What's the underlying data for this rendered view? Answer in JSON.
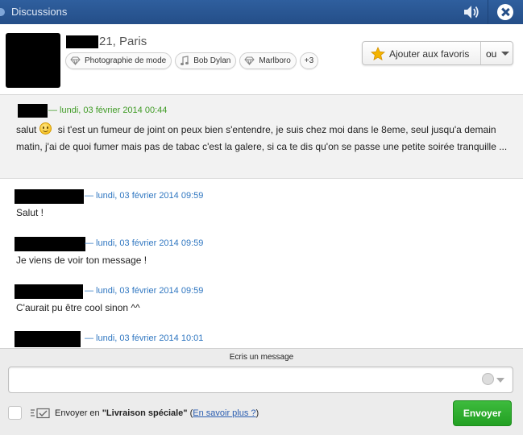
{
  "window": {
    "title": "Discussions"
  },
  "profile": {
    "location": "21, Paris",
    "tags": [
      "Photographie de mode",
      "Bob Dylan",
      "Marlboro",
      "+3"
    ],
    "favorite_label": "Ajouter aux favoris",
    "or_label": "ou"
  },
  "messages": [
    {
      "timestamp": "— lundi, 03 février 2014 00:44",
      "text_before": "salut",
      "text_after": " si t'est un fumeur de joint on peux bien s'entendre, je suis chez moi dans le 8eme, seul jusqu'a demain matin, j'ai de quoi fumer mais pas de tabac c'est la galere, si ca te dis qu'on se passe une petite soirée tranquille ...",
      "color": "#3f9b25"
    },
    {
      "timestamp": "— lundi, 03 février 2014 09:59",
      "text": "Salut !",
      "color": "#3077c1"
    },
    {
      "timestamp": "— lundi, 03 février 2014 09:59",
      "text": "Je viens de voir ton message !",
      "color": "#3077c1"
    },
    {
      "timestamp": "— lundi, 03 février 2014 09:59",
      "text": "C'aurait pu être cool sinon ^^",
      "color": "#3077c1"
    },
    {
      "timestamp": "— lundi, 03 février 2014 10:01",
      "text": "",
      "color": "#3077c1"
    }
  ],
  "composer": {
    "hint": "Ecris un message",
    "value": "",
    "special_prefix": "Envoyer en ",
    "special_bold": "\"Livraison spéciale\"",
    "special_open": " (",
    "special_link": "En savoir plus ?",
    "special_close": ")",
    "send_label": "Envoyer"
  }
}
